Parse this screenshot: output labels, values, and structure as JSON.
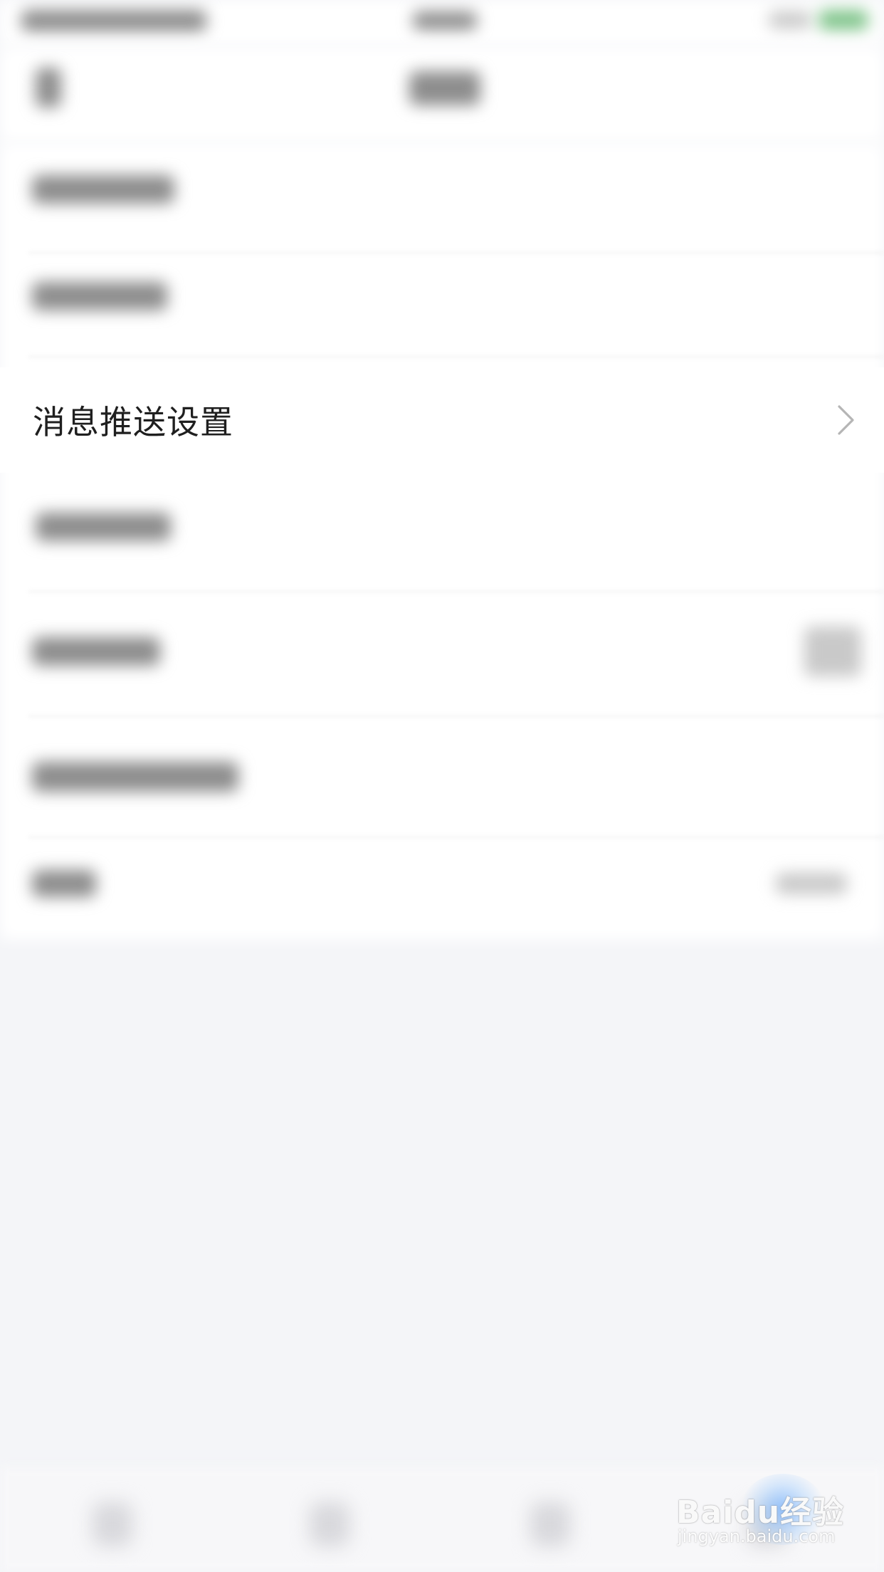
{
  "focused_row": {
    "label": "消息推送设置",
    "chevron_icon": "chevron-right-icon"
  },
  "watermark": {
    "brand": "Baidu经验",
    "url": "jingyan.baidu.com"
  },
  "colors": {
    "page_background": "#f4f5f8",
    "row_background": "#ffffff",
    "text_primary": "#1f1f1f",
    "chevron": "#b5b5b5",
    "status_battery": "#7fc48a"
  }
}
